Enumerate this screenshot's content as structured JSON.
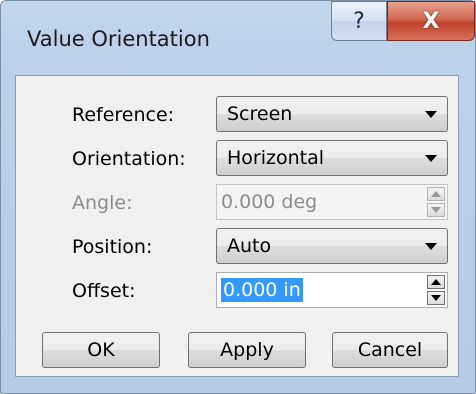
{
  "window": {
    "title": "Value Orientation",
    "help_glyph": "?",
    "close_glyph": "X"
  },
  "form": {
    "reference": {
      "label": "Reference:",
      "value": "Screen"
    },
    "orientation": {
      "label": "Orientation:",
      "value": "Horizontal"
    },
    "angle": {
      "label": "Angle:",
      "value": "0.000 deg",
      "enabled": false
    },
    "position": {
      "label": "Position:",
      "value": "Auto"
    },
    "offset": {
      "label": "Offset:",
      "value": "0.000 in",
      "selected": true
    }
  },
  "buttons": {
    "ok": "OK",
    "apply": "Apply",
    "cancel": "Cancel"
  },
  "colors": {
    "close_button": "#c0432a",
    "selection": "#3399ff",
    "frame": "#b5cbe6"
  }
}
